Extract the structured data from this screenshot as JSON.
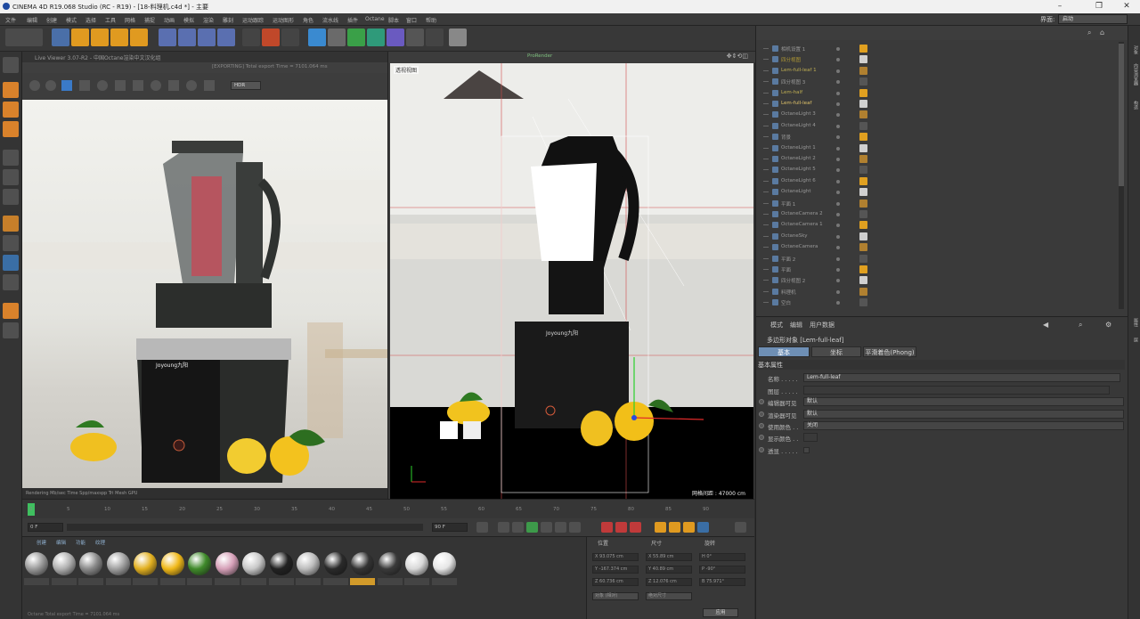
{
  "window": {
    "title": "CINEMA 4D R19.068 Studio (RC - R19) - [18-料理机.c4d *] - 主要",
    "layout_label": "界面:",
    "layout_value": "启动"
  },
  "menu": [
    "文件",
    "编辑",
    "创建",
    "模式",
    "选择",
    "工具",
    "网格",
    "捕捉",
    "动画",
    "模拟",
    "渲染",
    "雕刻",
    "运动跟踪",
    "运动图形",
    "角色",
    "流水线",
    "插件",
    "Octane",
    "脚本",
    "窗口",
    "帮助"
  ],
  "live_viewer": {
    "title": "Live Viewer 3.07-R2 - 中国Octane渲染中文汉化组",
    "export_text": "[EXPORTING] Total export Time = 7101.064 ms",
    "mode_value": "HDR",
    "status": "Rendering  Mb/sec  Time  Spp/maxspp  Tri  Mesh  GPU"
  },
  "viewport": {
    "label": "透视视图",
    "grid_label": "网格间距 : 47000 cm",
    "renderer_tab": "ProRender"
  },
  "objects": [
    {
      "name": "相机设置 1",
      "color": "#999"
    },
    {
      "name": "四分视图",
      "color": "#b29a34"
    },
    {
      "name": "Lem-full-leaf 1",
      "color": "#bfae52"
    },
    {
      "name": "四分视图 3",
      "color": "#999"
    },
    {
      "name": "Lem-half",
      "color": "#bfae52"
    },
    {
      "name": "Lem-full-leaf",
      "color": "#e0c36a"
    },
    {
      "name": "OctaneLight 3",
      "color": "#999"
    },
    {
      "name": "OctaneLight 4",
      "color": "#999"
    },
    {
      "name": "背景",
      "color": "#999"
    },
    {
      "name": "OctaneLight 1",
      "color": "#999"
    },
    {
      "name": "OctaneLight 2",
      "color": "#999"
    },
    {
      "name": "OctaneLight 5",
      "color": "#999"
    },
    {
      "name": "OctaneLight 6",
      "color": "#999"
    },
    {
      "name": "OctaneLight",
      "color": "#999"
    },
    {
      "name": "平面 1",
      "color": "#999"
    },
    {
      "name": "OctaneCamera 2",
      "color": "#999"
    },
    {
      "name": "OctaneCamera 1",
      "color": "#999"
    },
    {
      "name": "OctaneSky",
      "color": "#999"
    },
    {
      "name": "OctaneCamera",
      "color": "#999"
    },
    {
      "name": "平面 2",
      "color": "#999"
    },
    {
      "name": "平面",
      "color": "#999"
    },
    {
      "name": "四分视图 2",
      "color": "#999"
    },
    {
      "name": "料理机",
      "color": "#999"
    },
    {
      "name": "空白",
      "color": "#999"
    }
  ],
  "attributes": {
    "menu": [
      "模式",
      "编辑",
      "用户数据"
    ],
    "object_title": "多边形对象 [Lem-full-leaf]",
    "tabs": [
      "基本",
      "坐标",
      "平滑着色(Phong)"
    ],
    "section": "基本属性",
    "fields": [
      {
        "label": "名称 . . . . .",
        "value": "Lem-full-leaf"
      },
      {
        "label": "图层 . . . . .",
        "value": ""
      },
      {
        "label": "编辑器可见",
        "value": "默认"
      },
      {
        "label": "渲染器可见",
        "value": "默认"
      },
      {
        "label": "使用颜色 . .",
        "value": "关闭"
      },
      {
        "label": "显示颜色 . .",
        "value": ""
      },
      {
        "label": "透显 . . . . .",
        "value": ""
      }
    ]
  },
  "timeline": {
    "ticks": [
      "0",
      "5",
      "10",
      "15",
      "20",
      "25",
      "30",
      "35",
      "40",
      "45",
      "50",
      "55",
      "60",
      "65",
      "70",
      "75",
      "80",
      "85",
      "90"
    ],
    "start": "0 F",
    "end": "90 F"
  },
  "materials": {
    "menu": [
      "创建",
      "编辑",
      "功能",
      "纹理"
    ],
    "items": [
      {
        "color": "#9a9a9a"
      },
      {
        "color": "#b0b0b0"
      },
      {
        "color": "#8a8a8a"
      },
      {
        "color": "#a0a0a0"
      },
      {
        "color": "#e2b020"
      },
      {
        "color": "#f0b818"
      },
      {
        "color": "#3f8a2a"
      },
      {
        "color": "#d6a0b8"
      },
      {
        "color": "#c8c8c8"
      },
      {
        "color": "#222222"
      },
      {
        "color": "#bcbcbc"
      },
      {
        "color": "#2a2a2a"
      },
      {
        "color": "#333333",
        "selected": true
      },
      {
        "color": "#3a3a3a"
      },
      {
        "color": "#d8d8d8"
      },
      {
        "color": "#e6e6e6"
      }
    ],
    "status": "Octane Total export Time = 7101.064 ms"
  },
  "coords": {
    "headers": [
      "位置",
      "尺寸",
      "旋转"
    ],
    "rows": [
      [
        "X  93.075 cm",
        "X  55.89 cm",
        "H  0°"
      ],
      [
        "Y  -167.374 cm",
        "Y  40.89 cm",
        "P  -90°"
      ],
      [
        "Z  60.736 cm",
        "Z  12.076 cm",
        "B  75.971°"
      ]
    ],
    "mode1": "对象 (相对)",
    "mode2": "绝对尺寸",
    "apply": "应用"
  },
  "right_tabs": [
    "对象",
    "内容浏览器",
    "构造",
    "属性",
    "层"
  ]
}
